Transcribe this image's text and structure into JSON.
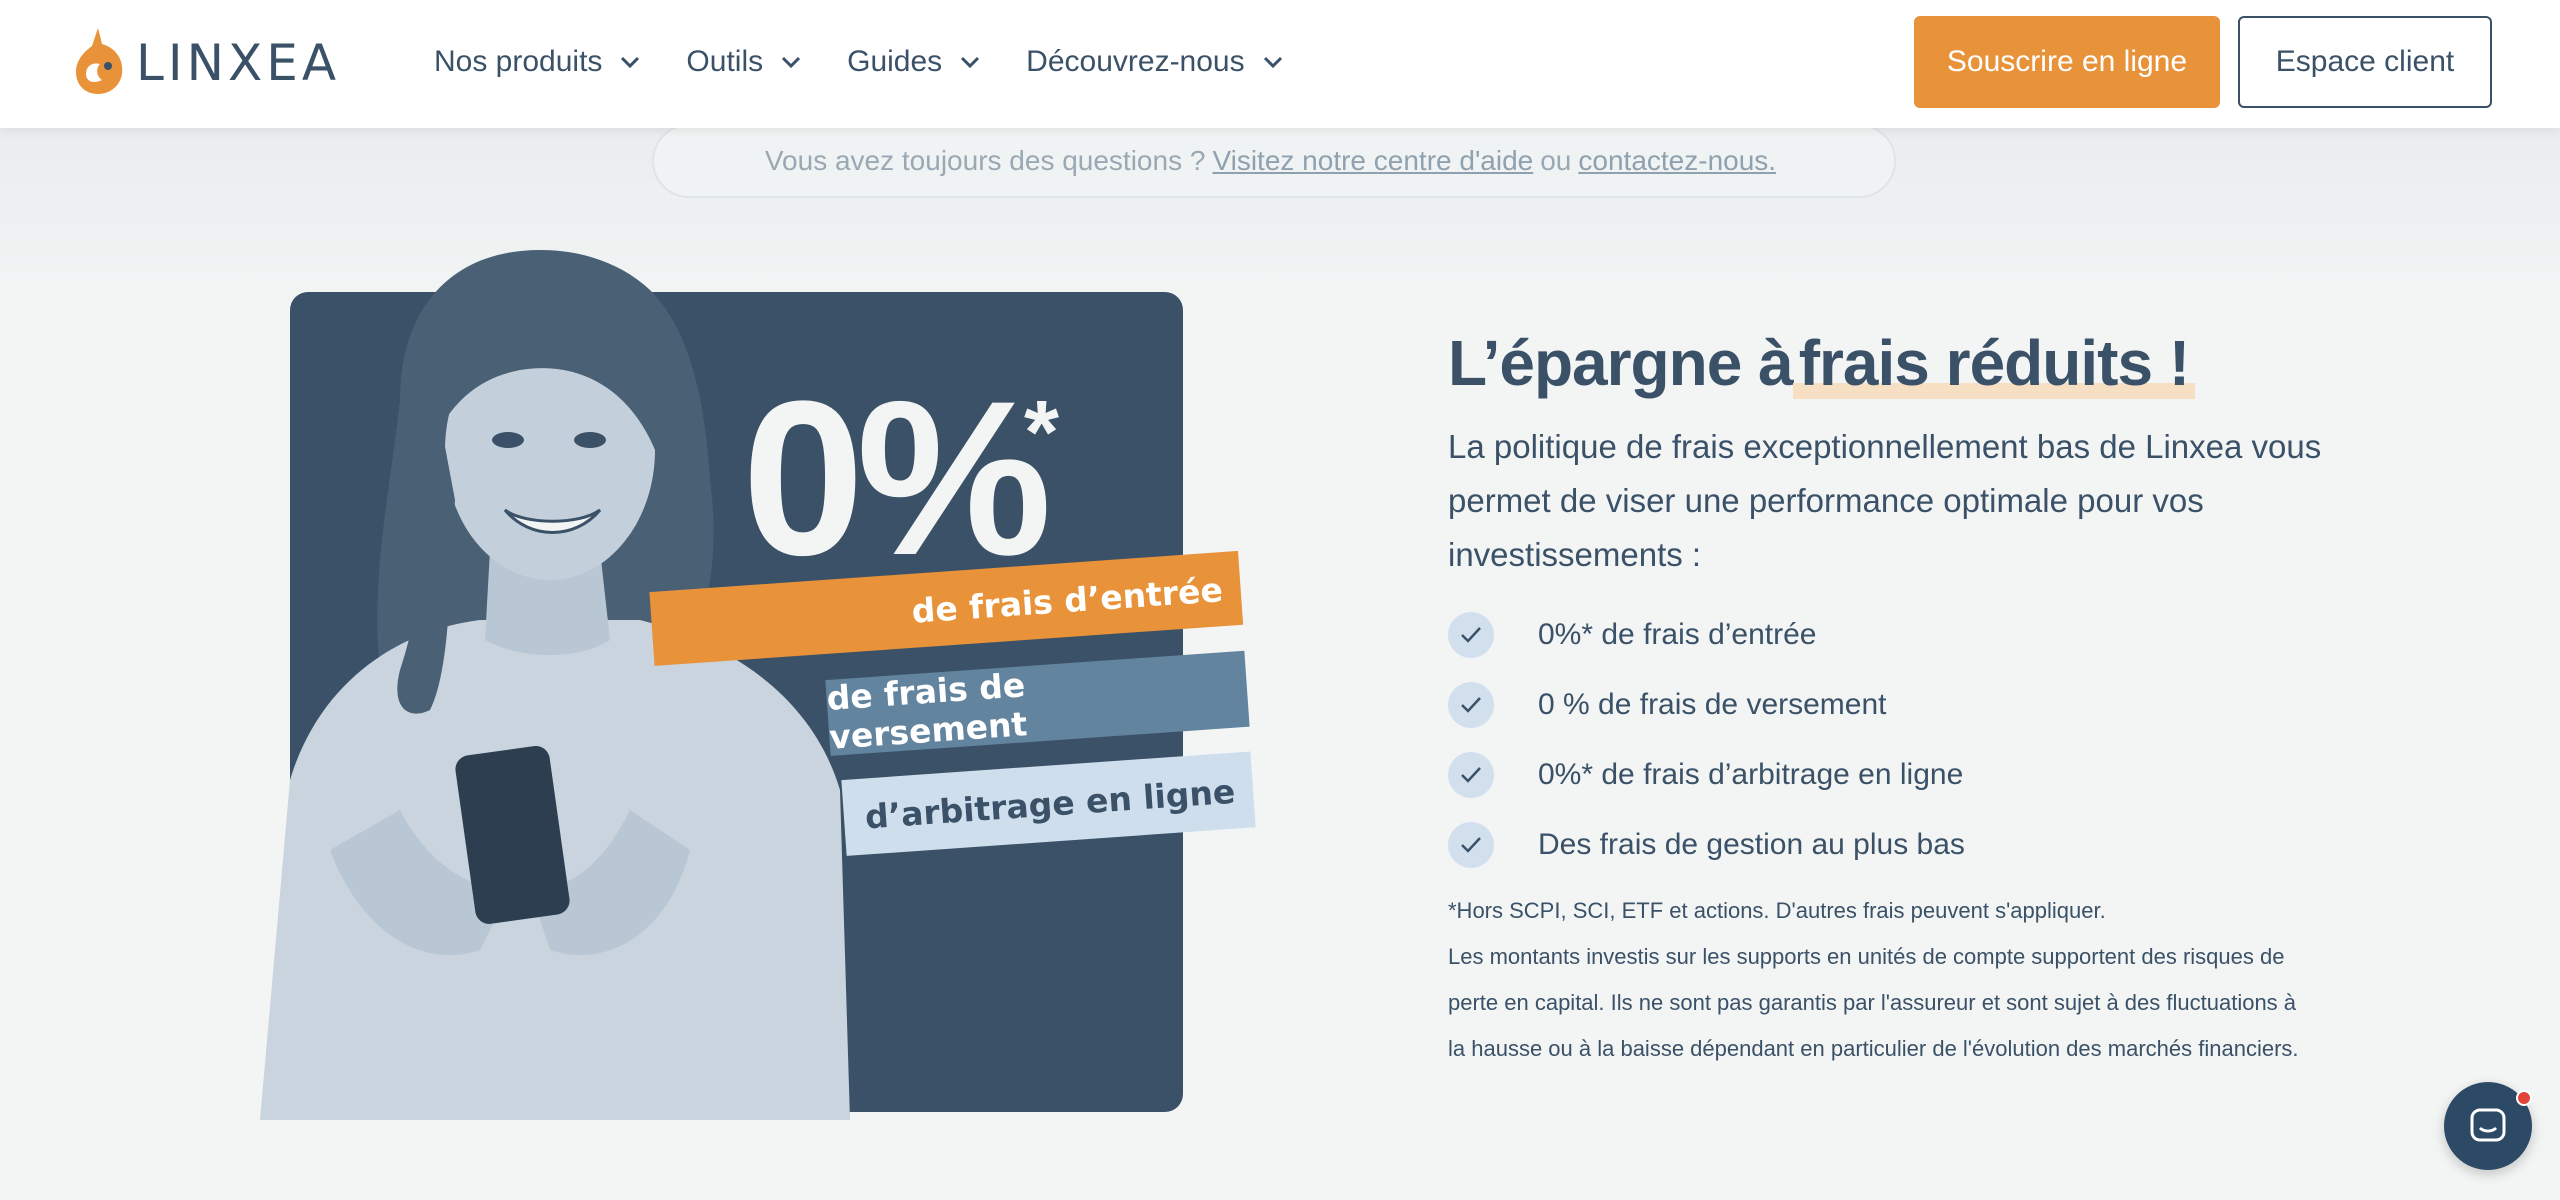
{
  "header": {
    "logo_text": "LINXEA",
    "nav": [
      {
        "label": "Nos produits"
      },
      {
        "label": "Outils"
      },
      {
        "label": "Guides"
      },
      {
        "label": "Découvrez-nous"
      }
    ],
    "subscribe_label": "Souscrire en ligne",
    "client_label": "Espace client"
  },
  "help": {
    "text": "Vous avez toujours des questions ?",
    "help_link": "Visitez notre centre d'aide",
    "or": "ou",
    "contact_link": "contactez-nous."
  },
  "hero": {
    "percent": "0%",
    "asterisk": "*",
    "ribbons": [
      "de frais d’entrée",
      "de frais de versement",
      "d’arbitrage en ligne"
    ]
  },
  "main": {
    "title_prefix": "L’épargne à",
    "title_highlight": "frais réduits !",
    "intro": "La politique de frais exceptionnellement bas de Linxea vous permet de viser une performance optimale pour vos investissements :",
    "features": [
      "0%* de frais d’entrée",
      "0 % de frais de versement",
      "0%* de frais d’arbitrage en ligne",
      "Des frais de gestion au plus bas"
    ],
    "disclaimer_1": "*Hors SCPI, SCI, ETF et actions. D'autres frais peuvent s'appliquer.",
    "disclaimer_2": "Les montants investis sur les supports en unités de compte supportent des risques de perte en capital. Ils ne sont pas garantis par l'assureur et sont sujet à des fluctuations à la hausse ou à la baisse dépendant en particulier de l'évolution des marchés financiers."
  },
  "colors": {
    "brand_orange": "#e8923a",
    "navy": "#3a5167",
    "steel_blue": "#62849f",
    "light_blue": "#cfdeec"
  },
  "icons": [
    "linxea-logo-icon",
    "chevron-down-icon",
    "check-icon",
    "chat-icon"
  ]
}
